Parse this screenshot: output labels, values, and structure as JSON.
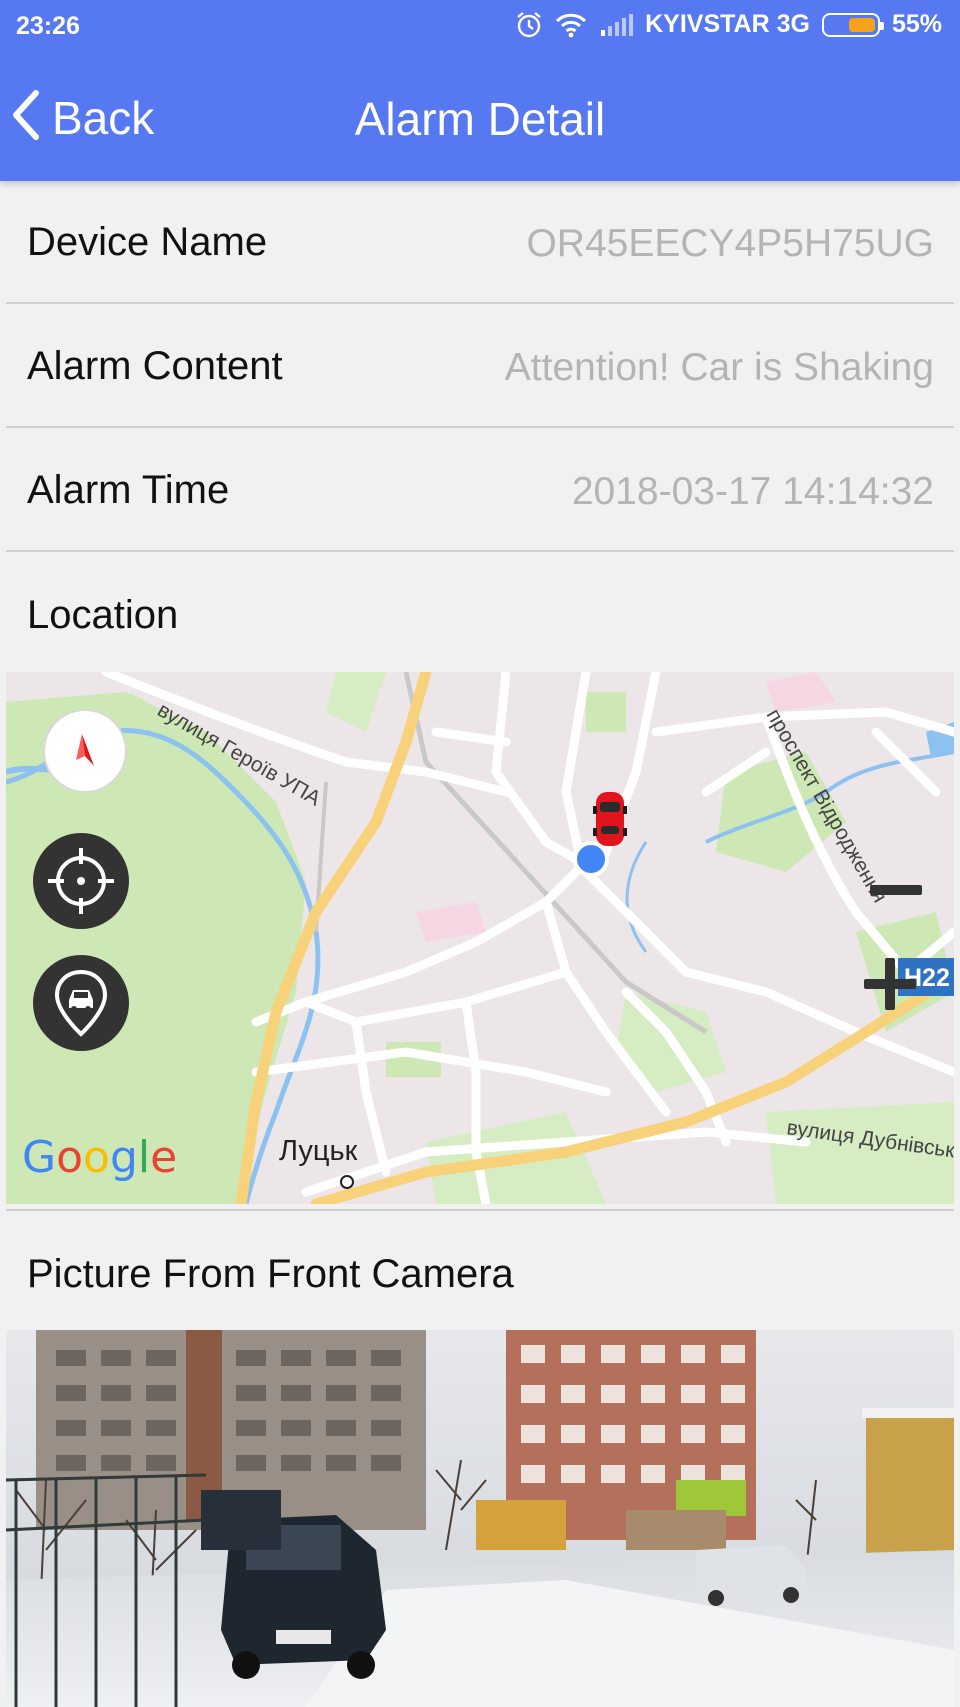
{
  "status_bar": {
    "time": "23:26",
    "carrier": "KYIVSTAR 3G",
    "battery_percent": "55%",
    "battery_level": 0.55,
    "icons": [
      "alarm-clock-icon",
      "wifi-icon",
      "signal-icon",
      "battery-icon"
    ]
  },
  "navbar": {
    "back_label": "Back",
    "title": "Alarm Detail",
    "back_icon": "chevron-left-icon"
  },
  "details": {
    "device_name_label": "Device Name",
    "device_name_value": "OR45EECY4P5H75UG",
    "alarm_content_label": "Alarm Content",
    "alarm_content_value": "Attention! Car is Shaking",
    "alarm_time_label": "Alarm Time",
    "alarm_time_value": "2018-03-17 14:14:32"
  },
  "location": {
    "label": "Location",
    "map": {
      "street_1": "вулиця Героїв УПА",
      "street_2": "проспект Відродження",
      "street_3": "вулиця Дубнівська",
      "city": "Луцьк",
      "road_badge": "H22",
      "provider_logo": "Google",
      "controls": [
        "compass-icon",
        "locate-me-icon",
        "car-location-icon",
        "zoom-out-icon",
        "zoom-in-icon"
      ]
    }
  },
  "camera": {
    "label": "Picture From Front Camera"
  },
  "colors": {
    "primary": "#5678f1",
    "background": "#f1f1f1",
    "value_text": "#b4b4b4",
    "battery_fill": "#f7a21b",
    "map_road_major": "#f8d27a",
    "map_water": "#8cc1f0",
    "map_green": "#cde8b5",
    "marker_blue": "#4285f4",
    "car_red": "#e0141c"
  }
}
